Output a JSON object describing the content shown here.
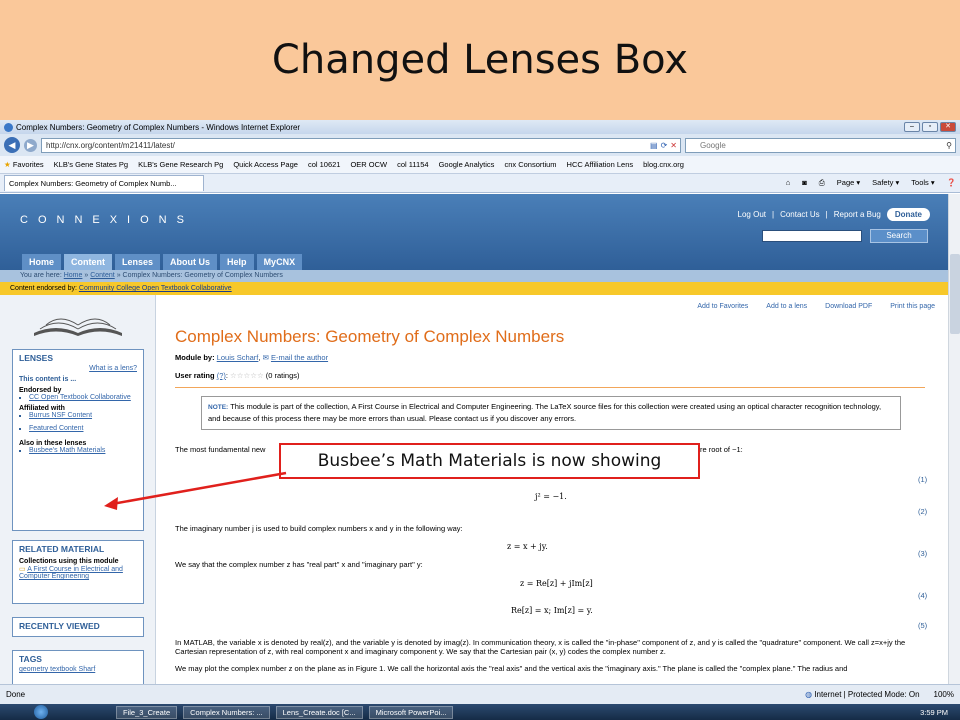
{
  "slide": {
    "title": "Changed Lenses Box"
  },
  "browser": {
    "window_title": "Complex Numbers: Geometry of Complex Numbers - Windows Internet Explorer",
    "address": "http://cnx.org/content/m21411/latest/",
    "search_placeholder": "Google",
    "favorites_label": "Favorites",
    "favorites": [
      "KLB's Gene States Pg",
      "KLB's Gene Research Pg",
      "Quick Access Page",
      "col 10621",
      "OER OCW",
      "col 11154",
      "Google Analytics",
      "cnx Consortium",
      "HCC Affiliation Lens",
      "blog.cnx.org"
    ],
    "tab_label": "Complex Numbers: Geometry of Complex Numb...",
    "commands": [
      "Page ▾",
      "Safety ▾",
      "Tools ▾"
    ],
    "status_left": "Done",
    "status_zone": "Internet | Protected Mode: On",
    "zoom": "100%"
  },
  "site": {
    "logo": "CONNEXIONS",
    "top_links": [
      "Log Out",
      "Contact Us",
      "Report a Bug"
    ],
    "donate": "Donate",
    "search_button": "Search",
    "nav_tabs": [
      "Home",
      "Content",
      "Lenses",
      "About Us",
      "Help",
      "MyCNX"
    ],
    "breadcrumb_prefix": "You are here:",
    "breadcrumb": [
      "Home",
      "Content",
      "Complex Numbers: Geometry of Complex Numbers"
    ],
    "endorsed_prefix": "Content endorsed by:",
    "endorsed_by": "Community College Open Textbook Collaborative"
  },
  "sidebar": {
    "lenses_title": "LENSES",
    "what_is_lens": "What is a lens?",
    "this_content": "This content is ...",
    "endorsed_label": "Endorsed by",
    "endorsed_item": "CC Open Textbook Collaborative",
    "affiliated_label": "Affiliated with",
    "affiliated_items": [
      "Burrus NSF Content",
      "Featured Content"
    ],
    "also_label": "Also in these lenses",
    "also_items": [
      "Busbee's Math Materials"
    ],
    "related_title": "RELATED MATERIAL",
    "collections_label": "Collections using this module",
    "collection_item": "A First Course in Electrical and Computer Engineering",
    "recently_viewed": "RECENTLY VIEWED",
    "tags_title": "TAGS",
    "tags_text": "geometry textbook Sharf"
  },
  "main": {
    "actions": [
      "Add to Favorites",
      "Add to a lens",
      "Download PDF",
      "Print this page"
    ],
    "title": "Complex Numbers: Geometry of Complex Numbers",
    "module_by_label": "Module by:",
    "author": "Louis Scharf",
    "email_author": "E-mail the author",
    "rating_label": "User rating",
    "rating_help": "(?)",
    "rating_count": "(0 ratings)",
    "note_label": "NOTE:",
    "note_text": "This module is part of the collection, A First Course in Electrical and Computer Engineering. The LaTeX source files for this collection were created using an optical character recognition technology, and because of this process there may be more errors than usual. Please contact us if you discover any errors.",
    "para1": "The most fundamental new",
    "para1_tail": "re root of −1:",
    "eq1": "j² = −1.",
    "para2": "The imaginary number j is used to build complex numbers x and y in the following way:",
    "eq2": "z = x + jy.",
    "para3": "We say that the complex number z has \"real part\" x and \"imaginary part\" y:",
    "eq3": "z = Re[z] + jIm[z]",
    "eq4": "Re[z] = x;  Im[z] = y.",
    "eq_numbers": [
      "(1)",
      "(2)",
      "(3)",
      "(4)",
      "(5)"
    ],
    "para4": "In MATLAB, the variable x is denoted by real(z), and the variable y is denoted by imag(z). In communication theory, x is called the \"in-phase\" component of z, and y is called the \"quadrature\" component. We call z=x+jy the Cartesian representation of z, with real component x and imaginary component y. We say that the Cartesian pair (x, y) codes the complex number z.",
    "para5": "We may plot the complex number z on the plane as in Figure 1. We call the horizontal axis the \"real axis\" and the vertical axis the \"imaginary axis.\" The plane is called the \"complex plane.\" The radius and"
  },
  "callout": {
    "text": "Busbee’s Math Materials is now showing"
  },
  "taskbar": {
    "buttons": [
      "File_3_Create",
      "Complex Numbers: ...",
      "Lens_Create.doc [C...",
      "Microsoft PowerPoi..."
    ],
    "clock": "3:59 PM"
  },
  "colors": {
    "accent_orange": "#e06d1a",
    "callout_red": "#e0201c",
    "header_blue": "#2f5f98",
    "slide_bg": "#fac89a"
  }
}
